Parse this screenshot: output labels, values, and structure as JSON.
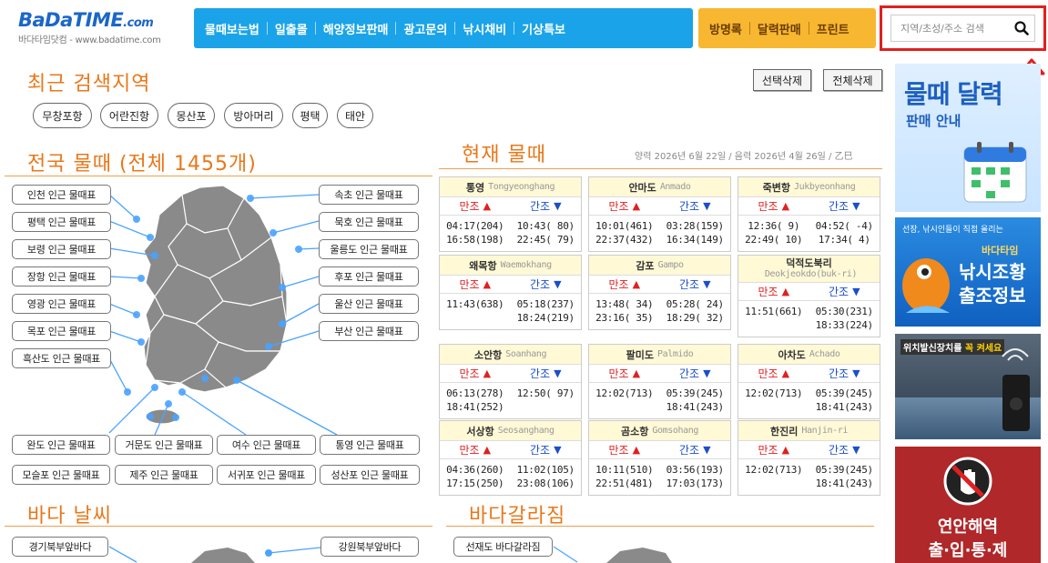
{
  "logo": {
    "main": "BaDaTIME",
    "domain": ".com",
    "sub": "바다타임닷컴 - www.badatime.com"
  },
  "nav_main": [
    "물때보는법",
    "일출몰",
    "해양정보판매",
    "광고문의",
    "낚시채비",
    "기상특보"
  ],
  "nav_side": [
    "방명록",
    "달력판매",
    "프린트"
  ],
  "search": {
    "placeholder": "지역/초성/주소 검색"
  },
  "recent": {
    "title": "최근 검색지역",
    "delete_selected": "선택삭제",
    "delete_all": "전체삭제",
    "tags": [
      "무창포항",
      "어란진항",
      "몽산포",
      "방아머리",
      "평택",
      "태안"
    ]
  },
  "national": {
    "title": "전국 물때 (전체 1455개)",
    "left": [
      "인천 인근 물때표",
      "평택 인근 물때표",
      "보령 인근 물때표",
      "장항 인근 물때표",
      "영광 인근 물때표",
      "목포 인근 물때표",
      "흑산도 인근 물때표"
    ],
    "right": [
      "속초 인근 물때표",
      "묵호 인근 물때표",
      "울릉도 인근 물때표",
      "후포 인근 물때표",
      "울산 인근 물때표",
      "부산 인근 물때표"
    ],
    "bottom1": [
      "완도 인근 물때표",
      "거문도 인근 물때표",
      "여수 인근 물때표",
      "통영 인근 물때표"
    ],
    "bottom2": [
      "모슬포 인근 물때표",
      "제주 인근 물때표",
      "서귀포 인근 물때표",
      "성산포 인근 물때표"
    ]
  },
  "current": {
    "title": "현재 물때",
    "date": "양력 2026년 6월 22일 / 음력 2026년 4월 26일 / 乙巳",
    "high_label": "만조",
    "low_label": "간조",
    "up_mark": "▲",
    "down_mark": "▼",
    "ports": [
      {
        "kname": "통영",
        "ename": "Tongyeonghang",
        "high": [
          "04:17(204)",
          "16:58(198)"
        ],
        "low": [
          "10:43( 80)",
          "22:45( 79)"
        ]
      },
      {
        "kname": "안마도",
        "ename": "Anmado",
        "high": [
          "10:01(461)",
          "22:37(432)"
        ],
        "low": [
          "03:28(159)",
          "16:34(149)"
        ]
      },
      {
        "kname": "죽변항",
        "ename": "Jukbyeonhang",
        "high": [
          "12:36(  9)",
          "22:49( 10)"
        ],
        "low": [
          "04:52( -4)",
          "17:34(  4)"
        ]
      },
      {
        "kname": "왜목항",
        "ename": "Waemokhang",
        "high": [
          "11:43(638)"
        ],
        "low": [
          "05:18(237)",
          "18:24(219)"
        ]
      },
      {
        "kname": "감포",
        "ename": "Gampo",
        "high": [
          "13:48( 34)",
          "23:16( 35)"
        ],
        "low": [
          "05:28( 24)",
          "18:29( 32)"
        ]
      },
      {
        "kname": "덕적도북리",
        "ename": "Deokjeokdo(buk-ri)",
        "high": [
          "11:51(661)"
        ],
        "low": [
          "05:30(231)",
          "18:33(224)"
        ]
      },
      {
        "kname": "소안항",
        "ename": "Soanhang",
        "high": [
          "06:13(278)",
          "18:41(252)"
        ],
        "low": [
          "12:50( 97)"
        ]
      },
      {
        "kname": "팔미도",
        "ename": "Palmido",
        "high": [
          "12:02(713)"
        ],
        "low": [
          "05:39(245)",
          "18:41(243)"
        ]
      },
      {
        "kname": "아차도",
        "ename": "Achado",
        "high": [
          "12:02(713)"
        ],
        "low": [
          "05:39(245)",
          "18:41(243)"
        ]
      },
      {
        "kname": "서상항",
        "ename": "Seosanghang",
        "high": [
          "04:36(260)",
          "17:15(250)"
        ],
        "low": [
          "11:02(105)",
          "23:08(106)"
        ]
      },
      {
        "kname": "곰소항",
        "ename": "Gomsohang",
        "high": [
          "10:11(510)",
          "22:51(481)"
        ],
        "low": [
          "03:56(193)",
          "17:03(173)"
        ]
      },
      {
        "kname": "한진리",
        "ename": "Hanjin-ri",
        "high": [
          "12:02(713)"
        ],
        "low": [
          "05:39(245)",
          "18:41(243)"
        ]
      }
    ]
  },
  "weather": {
    "title": "바다 날씨",
    "left": "경기북부앞바다",
    "right": "강원북부앞바다"
  },
  "parting": {
    "title": "바다갈라짐",
    "item": "선재도 바다갈라짐"
  },
  "ads": {
    "ad1_title": "물때 달력",
    "ad1_sub": "판매 안내",
    "ad2_top": "선장, 낚시인들이 직접 올리는",
    "ad2_brand": "바다타임",
    "ad2_title1": "낚시조황",
    "ad2_title2": "출조정보",
    "ad3_tag": "위치발신장치를",
    "ad3_tag2": "꼭 켜세요",
    "ad4_title1": "연안해역",
    "ad4_title2": "출·입·통·제"
  }
}
